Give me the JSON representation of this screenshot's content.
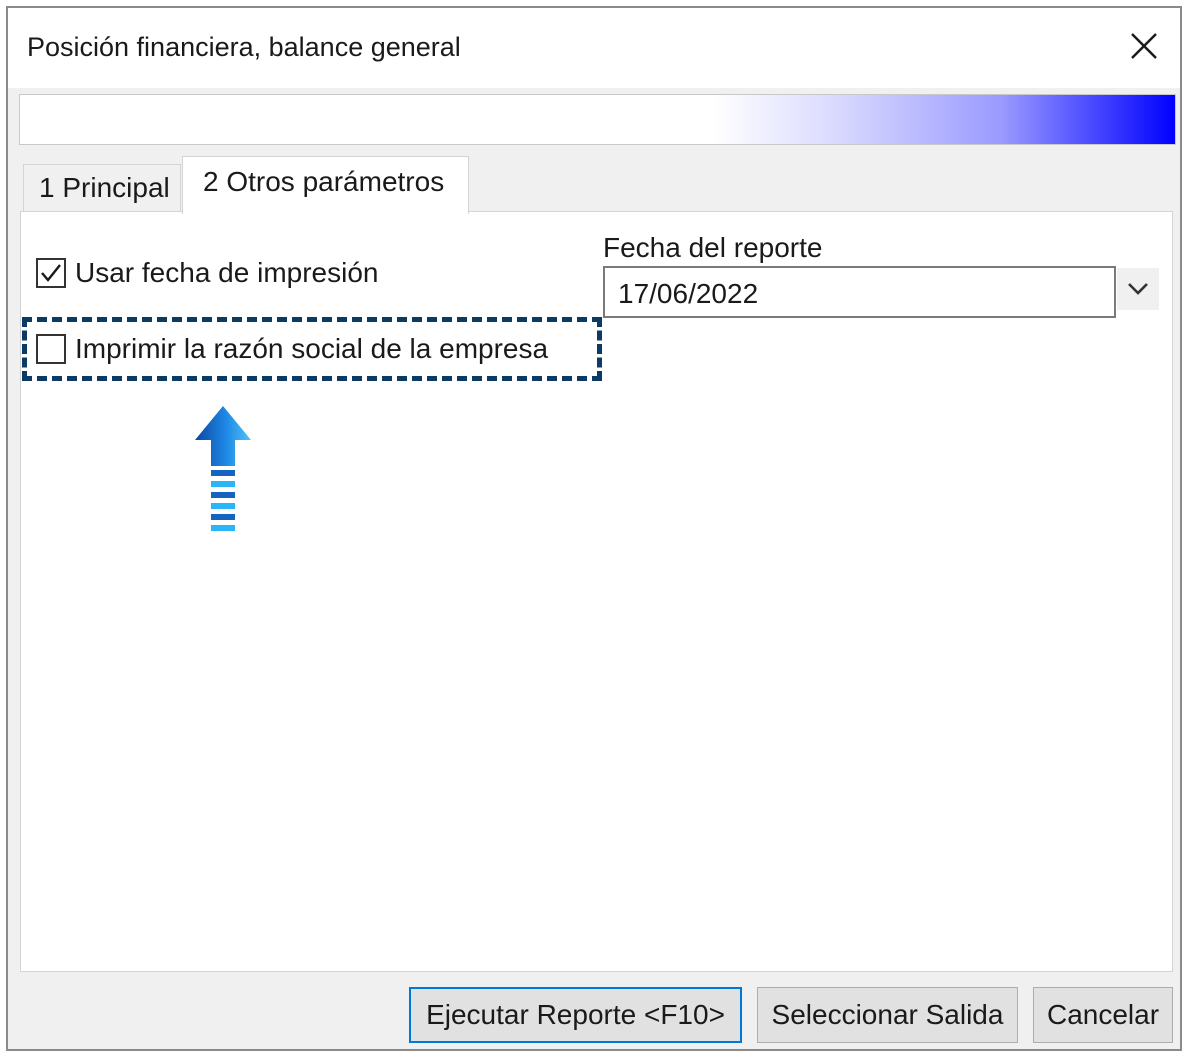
{
  "window": {
    "title": "Posición financiera, balance general",
    "close_icon": "close-icon"
  },
  "banner": {
    "gradient_colors": [
      "#ffffff",
      "#0000ff"
    ]
  },
  "tabs": [
    {
      "label": "1 Principal",
      "active": false
    },
    {
      "label": "2 Otros parámetros",
      "active": true
    }
  ],
  "options": {
    "use_print_date": {
      "label": "Usar fecha de impresión",
      "checked": true
    },
    "print_company_name": {
      "label": "Imprimir la razón social de la empresa",
      "checked": false
    }
  },
  "report_date": {
    "label": "Fecha del reporte",
    "value": "17/06/2022",
    "dropdown_icon": "chevron-down-icon"
  },
  "annotation": {
    "highlight_color": "#0b3a64",
    "arrow_icon": "arrow-up-icon",
    "arrow_colors": [
      "#1565c0",
      "#29b6f6"
    ]
  },
  "buttons": {
    "run_report": "Ejecutar Reporte <F10>",
    "select_output": "Seleccionar Salida",
    "cancel": "Cancelar"
  }
}
